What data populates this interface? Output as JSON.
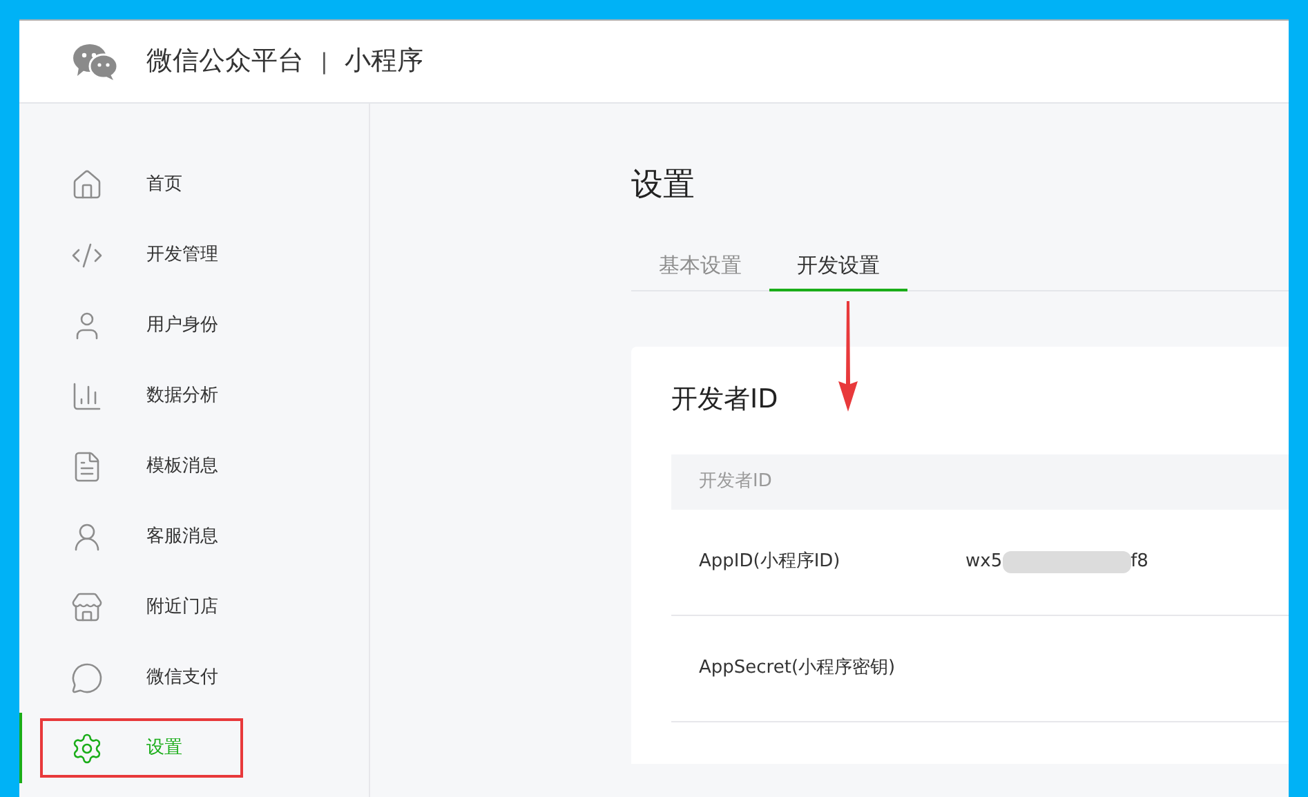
{
  "header": {
    "title": "微信公众平台",
    "separator": "|",
    "subtitle": "小程序"
  },
  "sidebar": {
    "items": [
      {
        "label": "首页",
        "selected": false
      },
      {
        "label": "开发管理",
        "selected": false
      },
      {
        "label": "用户身份",
        "selected": false
      },
      {
        "label": "数据分析",
        "selected": false
      },
      {
        "label": "模板消息",
        "selected": false
      },
      {
        "label": "客服消息",
        "selected": false
      },
      {
        "label": "附近门店",
        "selected": false
      },
      {
        "label": "微信支付",
        "selected": false
      },
      {
        "label": "设置",
        "selected": true
      }
    ]
  },
  "page": {
    "title": "设置",
    "tabs": [
      {
        "label": "基本设置",
        "selected": false
      },
      {
        "label": "开发设置",
        "selected": true
      }
    ]
  },
  "card": {
    "title": "开发者ID",
    "table": {
      "columns": [
        "开发者ID"
      ],
      "rows": [
        {
          "label": "AppID(小程序ID)",
          "value_start": "wx5",
          "value_end": "f8",
          "redacted": true
        },
        {
          "label": "AppSecret(小程序密钥)"
        }
      ]
    }
  }
}
